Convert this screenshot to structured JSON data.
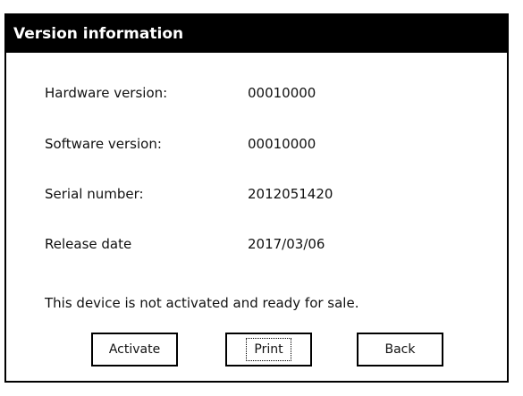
{
  "window": {
    "title": "Version information"
  },
  "info": [
    {
      "label": "Hardware version:",
      "value": "00010000"
    },
    {
      "label": "Software version:",
      "value": "00010000"
    },
    {
      "label": "Serial number:",
      "value": "2012051420"
    },
    {
      "label": "Release date",
      "value": "2017/03/06"
    }
  ],
  "status_message": "This device is not activated and ready for sale.",
  "buttons": {
    "activate": "Activate",
    "print": "Print",
    "back": "Back"
  }
}
